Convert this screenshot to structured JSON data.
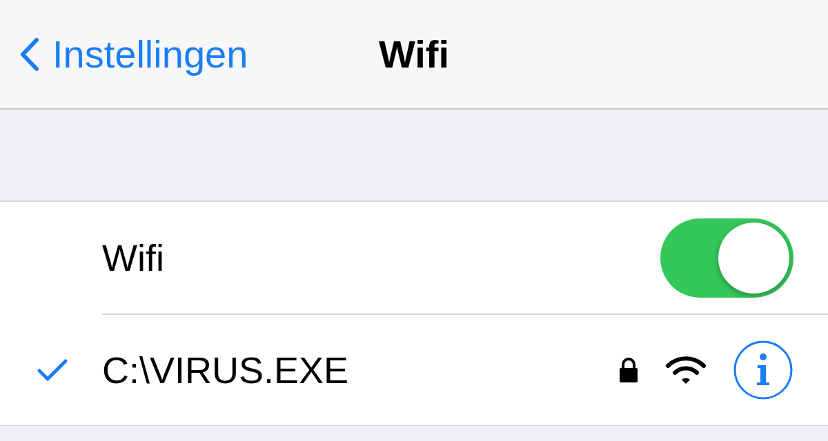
{
  "nav": {
    "back_label": "Instellingen",
    "title": "Wifi"
  },
  "wifi_row": {
    "label": "Wifi",
    "on": true
  },
  "networks": [
    {
      "name": "C:\\VIRUS.EXE",
      "selected": true,
      "locked": true
    }
  ]
}
